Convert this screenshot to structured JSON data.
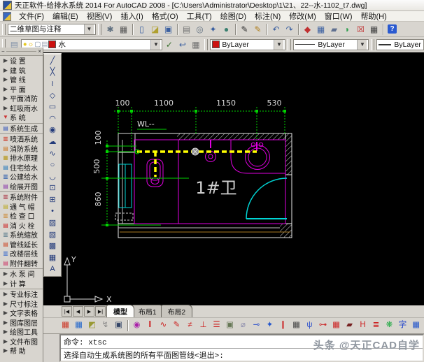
{
  "window": {
    "title": "天正软件-给排水系统 2014 For AutoCAD 2008 - [C:\\Users\\Administrator\\Desktop\\1\\21、22--水-1102_t7.dwg]"
  },
  "menu": {
    "items": [
      {
        "name": "menu-file",
        "label": "文件(F)"
      },
      {
        "name": "menu-edit",
        "label": "编辑(E)"
      },
      {
        "name": "menu-view",
        "label": "视图(V)"
      },
      {
        "name": "menu-insert",
        "label": "插入(I)"
      },
      {
        "name": "menu-format",
        "label": "格式(O)"
      },
      {
        "name": "menu-tools",
        "label": "工具(T)"
      },
      {
        "name": "menu-draw",
        "label": "绘图(D)"
      },
      {
        "name": "menu-dimension",
        "label": "标注(N)"
      },
      {
        "name": "menu-modify",
        "label": "修改(M)"
      },
      {
        "name": "menu-window",
        "label": "窗口(W)"
      },
      {
        "name": "menu-help",
        "label": "帮助(H)"
      }
    ]
  },
  "toolbar1": {
    "workspace_value": "二维草图与注释",
    "icons": [
      {
        "name": "workspace-settings-icon",
        "glyph": "✱",
        "color": "#607080"
      },
      {
        "name": "workspace-switch-icon",
        "glyph": "▦",
        "color": "#555555"
      },
      {
        "name": "new-file-icon",
        "glyph": "▯",
        "color": "#3a5fa0",
        "sep": true
      },
      {
        "name": "open-file-icon",
        "glyph": "◪",
        "color": "#b0a030"
      },
      {
        "name": "save-icon",
        "glyph": "▣",
        "color": "#3a5fa0"
      },
      {
        "name": "plot-icon",
        "glyph": "▤",
        "color": "#707070",
        "sep": true
      },
      {
        "name": "plot-preview-icon",
        "glyph": "◎",
        "color": "#607080"
      },
      {
        "name": "publish-icon",
        "glyph": "✦",
        "color": "#3a5fa0"
      },
      {
        "name": "hyperlink-icon",
        "glyph": "●",
        "color": "#3a8070"
      },
      {
        "name": "pencil-icon",
        "glyph": "✎",
        "color": "#303030",
        "sep": true
      },
      {
        "name": "brush-icon",
        "glyph": "✎",
        "color": "#b08020"
      },
      {
        "name": "undo-icon",
        "glyph": "↶",
        "color": "#3a5fa0",
        "sep": true
      },
      {
        "name": "redo-icon",
        "glyph": "↷",
        "color": "#3a5fa0"
      },
      {
        "name": "tz-custom-icon",
        "glyph": "◆",
        "color": "#c03030",
        "sep": true
      },
      {
        "name": "tz-library-icon",
        "glyph": "▦",
        "color": "#3a5fa0"
      },
      {
        "name": "tz-file-icon",
        "glyph": "▰",
        "color": "#607090"
      },
      {
        "name": "tz-convert-icon",
        "glyph": "◗",
        "color": "#30a050"
      },
      {
        "name": "tz-erase-icon",
        "glyph": "☒",
        "color": "#c03030"
      },
      {
        "name": "calculator-icon",
        "glyph": "▦",
        "color": "#404040"
      },
      {
        "name": "help-icon",
        "glyph": "?",
        "color": "#ffffff",
        "badge": true,
        "sep": true
      }
    ]
  },
  "toolbar2": {
    "layer_combo": {
      "icons": [
        {
          "name": "layer-on-icon",
          "glyph": "●",
          "color": "#e6c91f"
        },
        {
          "name": "layer-freeze-icon",
          "glyph": "☼",
          "color": "#e6b800"
        },
        {
          "name": "layer-lock-icon",
          "glyph": "▢",
          "color": "#7a8aa0"
        },
        {
          "name": "layer-plot-icon",
          "glyph": "▤",
          "color": "#98a0b0"
        }
      ],
      "layer_name": "水"
    },
    "right_icons": [
      {
        "name": "make-object-layer-current-icon",
        "glyph": "✓",
        "color": "#3a7030"
      },
      {
        "name": "layer-previous-icon",
        "glyph": "↩",
        "color": "#3a5fa0"
      },
      {
        "name": "layer-states-icon",
        "glyph": "▦",
        "color": "#707070"
      }
    ],
    "color_value": "ByLayer",
    "linetype_value": "ByLayer",
    "lineweight_value": "ByLayer"
  },
  "sidebar": {
    "items": [
      {
        "name": "sidebar-item-settings",
        "glyph": "▶",
        "color": "#444444",
        "label": "设  置"
      },
      {
        "name": "sidebar-item-building",
        "glyph": "▶",
        "color": "#444444",
        "label": "建  筑"
      },
      {
        "name": "sidebar-item-pipeline",
        "glyph": "▶",
        "color": "#444444",
        "label": "管  线"
      },
      {
        "name": "sidebar-item-plan",
        "glyph": "▶",
        "color": "#444444",
        "label": "平  面"
      },
      {
        "name": "sidebar-item-plan-fire",
        "glyph": "▶",
        "color": "#444444",
        "label": "平面消防"
      },
      {
        "name": "sidebar-item-siphon-rain",
        "glyph": "▶",
        "color": "#444444",
        "label": "虹吸雨水"
      },
      {
        "name": "sidebar-item-system",
        "glyph": "▼",
        "color": "#cc3333",
        "label": "系  统"
      },
      {
        "name": "sidebar-item-system-generate",
        "glyph": "▤",
        "color": "#3355bb",
        "label": "系统生成",
        "sep": true
      },
      {
        "name": "sidebar-item-sprinkler-system",
        "glyph": "▥",
        "color": "#cc3322",
        "label": "喷洒系统",
        "sep": true
      },
      {
        "name": "sidebar-item-fire-system",
        "glyph": "▤",
        "color": "#cc7722",
        "label": "消防系统"
      },
      {
        "name": "sidebar-item-drainage-principle",
        "glyph": "▦",
        "color": "#b89a22",
        "label": "排水原理"
      },
      {
        "name": "sidebar-item-residential-water",
        "glyph": "▤",
        "color": "#2277bb",
        "label": "住宅给水"
      },
      {
        "name": "sidebar-item-public-water",
        "glyph": "▥",
        "color": "#2255aa",
        "label": "公建给水"
      },
      {
        "name": "sidebar-item-expand-diagram",
        "glyph": "▤",
        "color": "#8833aa",
        "label": "绘展开图"
      },
      {
        "name": "sidebar-item-system-accessory",
        "glyph": "▥",
        "color": "#aa3344",
        "label": "系统附件",
        "sep": true
      },
      {
        "name": "sidebar-item-vent-cap",
        "glyph": "▤",
        "color": "#bbaa22",
        "label": "通 气 帽"
      },
      {
        "name": "sidebar-item-inspection-port",
        "glyph": "▥",
        "color": "#cc8833",
        "label": "检 查 口"
      },
      {
        "name": "sidebar-item-fire-hydrant",
        "glyph": "▤",
        "color": "#cc2222",
        "label": "消 火 栓"
      },
      {
        "name": "sidebar-item-system-scale",
        "glyph": "▥",
        "color": "#557788",
        "label": "系统缩放"
      },
      {
        "name": "sidebar-item-pipe-extend",
        "glyph": "▤",
        "color": "#cc4422",
        "label": "管线延长"
      },
      {
        "name": "sidebar-item-floor-line-edit",
        "glyph": "▥",
        "color": "#3366cc",
        "label": "改楼层线"
      },
      {
        "name": "sidebar-item-accessory-flip",
        "glyph": "▤",
        "color": "#cc3366",
        "label": "附件翻转"
      },
      {
        "name": "sidebar-item-pump-room",
        "glyph": "▶",
        "color": "#444444",
        "label": "水 泵 间",
        "sep": true
      },
      {
        "name": "sidebar-item-calculation",
        "glyph": "▶",
        "color": "#444444",
        "label": "计  算"
      },
      {
        "name": "sidebar-item-professional-dim",
        "glyph": "▶",
        "color": "#444444",
        "label": "专业标注",
        "sep": true
      },
      {
        "name": "sidebar-item-dimension",
        "glyph": "▶",
        "color": "#444444",
        "label": "尺寸标注"
      },
      {
        "name": "sidebar-item-text-table",
        "glyph": "▶",
        "color": "#444444",
        "label": "文字表格"
      },
      {
        "name": "sidebar-item-library-layer",
        "glyph": "▶",
        "color": "#444444",
        "label": "图库图层"
      },
      {
        "name": "sidebar-item-draw-tools",
        "glyph": "▶",
        "color": "#444444",
        "label": "绘图工具"
      },
      {
        "name": "sidebar-item-file-layout",
        "glyph": "▶",
        "color": "#444444",
        "label": "文件布图"
      },
      {
        "name": "sidebar-item-help",
        "glyph": "▶",
        "color": "#444444",
        "label": "帮  助"
      }
    ]
  },
  "draw_toolbar": {
    "tools": [
      {
        "name": "line-icon",
        "glyph": "╱"
      },
      {
        "name": "construction-line-icon",
        "glyph": "╳"
      },
      {
        "name": "polyline-icon",
        "glyph": "≀"
      },
      {
        "name": "polygon-icon",
        "glyph": "◇"
      },
      {
        "name": "rectangle-icon",
        "glyph": "▭"
      },
      {
        "name": "arc-icon",
        "glyph": "◠"
      },
      {
        "name": "circle-icon",
        "glyph": "◉"
      },
      {
        "name": "revision-cloud-icon",
        "glyph": "☁"
      },
      {
        "name": "spline-icon",
        "glyph": "∿"
      },
      {
        "name": "ellipse-icon",
        "glyph": "○"
      },
      {
        "name": "ellipse-arc-icon",
        "glyph": "◡"
      },
      {
        "name": "insert-block-icon",
        "glyph": "⊡"
      },
      {
        "name": "make-block-icon",
        "glyph": "⊞"
      },
      {
        "name": "point-icon",
        "glyph": "•"
      },
      {
        "name": "hatch-icon",
        "glyph": "▨"
      },
      {
        "name": "gradient-icon",
        "glyph": "▧"
      },
      {
        "name": "region-icon",
        "glyph": "▩"
      },
      {
        "name": "table-icon",
        "glyph": "▦"
      },
      {
        "name": "mtext-icon",
        "glyph": "A"
      }
    ]
  },
  "drawing": {
    "dims_top": [
      "100",
      "1100",
      "1150",
      "530"
    ],
    "dims_left": [
      "100",
      "500",
      "860"
    ],
    "wl_label": "WL--",
    "room_label": "1#卫",
    "ucs": {
      "x": "X",
      "y": "Y"
    }
  },
  "tabs": {
    "model": "模型",
    "layout1": "布局1",
    "layout2": "布局2",
    "nav": [
      "|◀",
      "◀",
      "▶",
      "▶|"
    ]
  },
  "bottom_toolbar": {
    "icons": [
      {
        "name": "tz-palette-icon",
        "glyph": "▦",
        "color": "#cc3322"
      },
      {
        "name": "tz-layout-icon",
        "glyph": "▦",
        "color": "#2266cc"
      },
      {
        "name": "tz-style-icon",
        "glyph": "◩",
        "color": "#999933"
      },
      {
        "name": "tz-lightning-icon",
        "glyph": "↯",
        "color": "#808080"
      },
      {
        "name": "tz-save-icon",
        "glyph": "▣",
        "color": "#334466"
      },
      {
        "name": "tz-view-icon",
        "glyph": "◉",
        "color": "#aa22aa",
        "sep": true
      },
      {
        "name": "tz-pipe-icon",
        "glyph": "‖",
        "color": "#cc2222"
      },
      {
        "name": "tz-curve-icon",
        "glyph": "∿",
        "color": "#cc2222"
      },
      {
        "name": "tz-draw-pipe-icon",
        "glyph": "✎",
        "color": "#cc2222"
      },
      {
        "name": "tz-slope-icon",
        "glyph": "≠",
        "color": "#cc2222"
      },
      {
        "name": "tz-riser-icon",
        "glyph": "⊥",
        "color": "#cc2222"
      },
      {
        "name": "tz-multiline-icon",
        "glyph": "☰",
        "color": "#cc2222"
      },
      {
        "name": "tz-block-icon",
        "glyph": "▣",
        "color": "#667755"
      },
      {
        "name": "tz-measure-icon",
        "glyph": "⌀",
        "color": "#8888aa"
      },
      {
        "name": "tz-connect-icon",
        "glyph": "⊸",
        "color": "#3355cc"
      },
      {
        "name": "tz-valve-icon",
        "glyph": "✦",
        "color": "#2255cc"
      },
      {
        "name": "tz-break-icon",
        "glyph": "∥",
        "color": "#cc2222"
      },
      {
        "name": "tz-grid-icon",
        "glyph": "▦",
        "color": "#444444"
      },
      {
        "name": "tz-system-gen-icon",
        "glyph": "ψ",
        "color": "#3355cc"
      },
      {
        "name": "tz-node-icon",
        "glyph": "⊶",
        "color": "#cc3333"
      },
      {
        "name": "tz-radiator-icon",
        "glyph": "▦",
        "color": "#cc2222"
      },
      {
        "name": "tz-flag-icon",
        "glyph": "▰",
        "color": "#772222"
      },
      {
        "name": "tz-break-pipe-icon",
        "glyph": "H",
        "color": "#cc2222"
      },
      {
        "name": "tz-stack-icon",
        "glyph": "≣",
        "color": "#cc2222"
      },
      {
        "name": "tz-paint-icon",
        "glyph": "❋",
        "color": "#22aa44"
      },
      {
        "name": "tz-text-style-icon",
        "glyph": "字",
        "color": "#2244cc"
      },
      {
        "name": "tz-table-icon",
        "glyph": "▦",
        "color": "#2255cc"
      },
      {
        "name": "tz-scale-icon",
        "glyph": "◿",
        "color": "#888888"
      },
      {
        "name": "tz-align-icon",
        "glyph": "⇶",
        "color": "#888888"
      },
      {
        "name": "tz-node-edit-icon",
        "glyph": "⊹",
        "color": "#888888"
      }
    ]
  },
  "command_line": {
    "line1": "命令: xtsc",
    "line2": "选择自动生成系统图的所有平面图管线<退出>:"
  },
  "watermark": "头条 @天正CAD自学",
  "colors": {
    "dim_green": "#00d400",
    "fixture_magenta": "#e000e0",
    "door_cyan": "#00d4d4",
    "pipe_yellow": "#ffff00",
    "wall_accent": "#a87820",
    "canvas_bg": "#000000"
  }
}
